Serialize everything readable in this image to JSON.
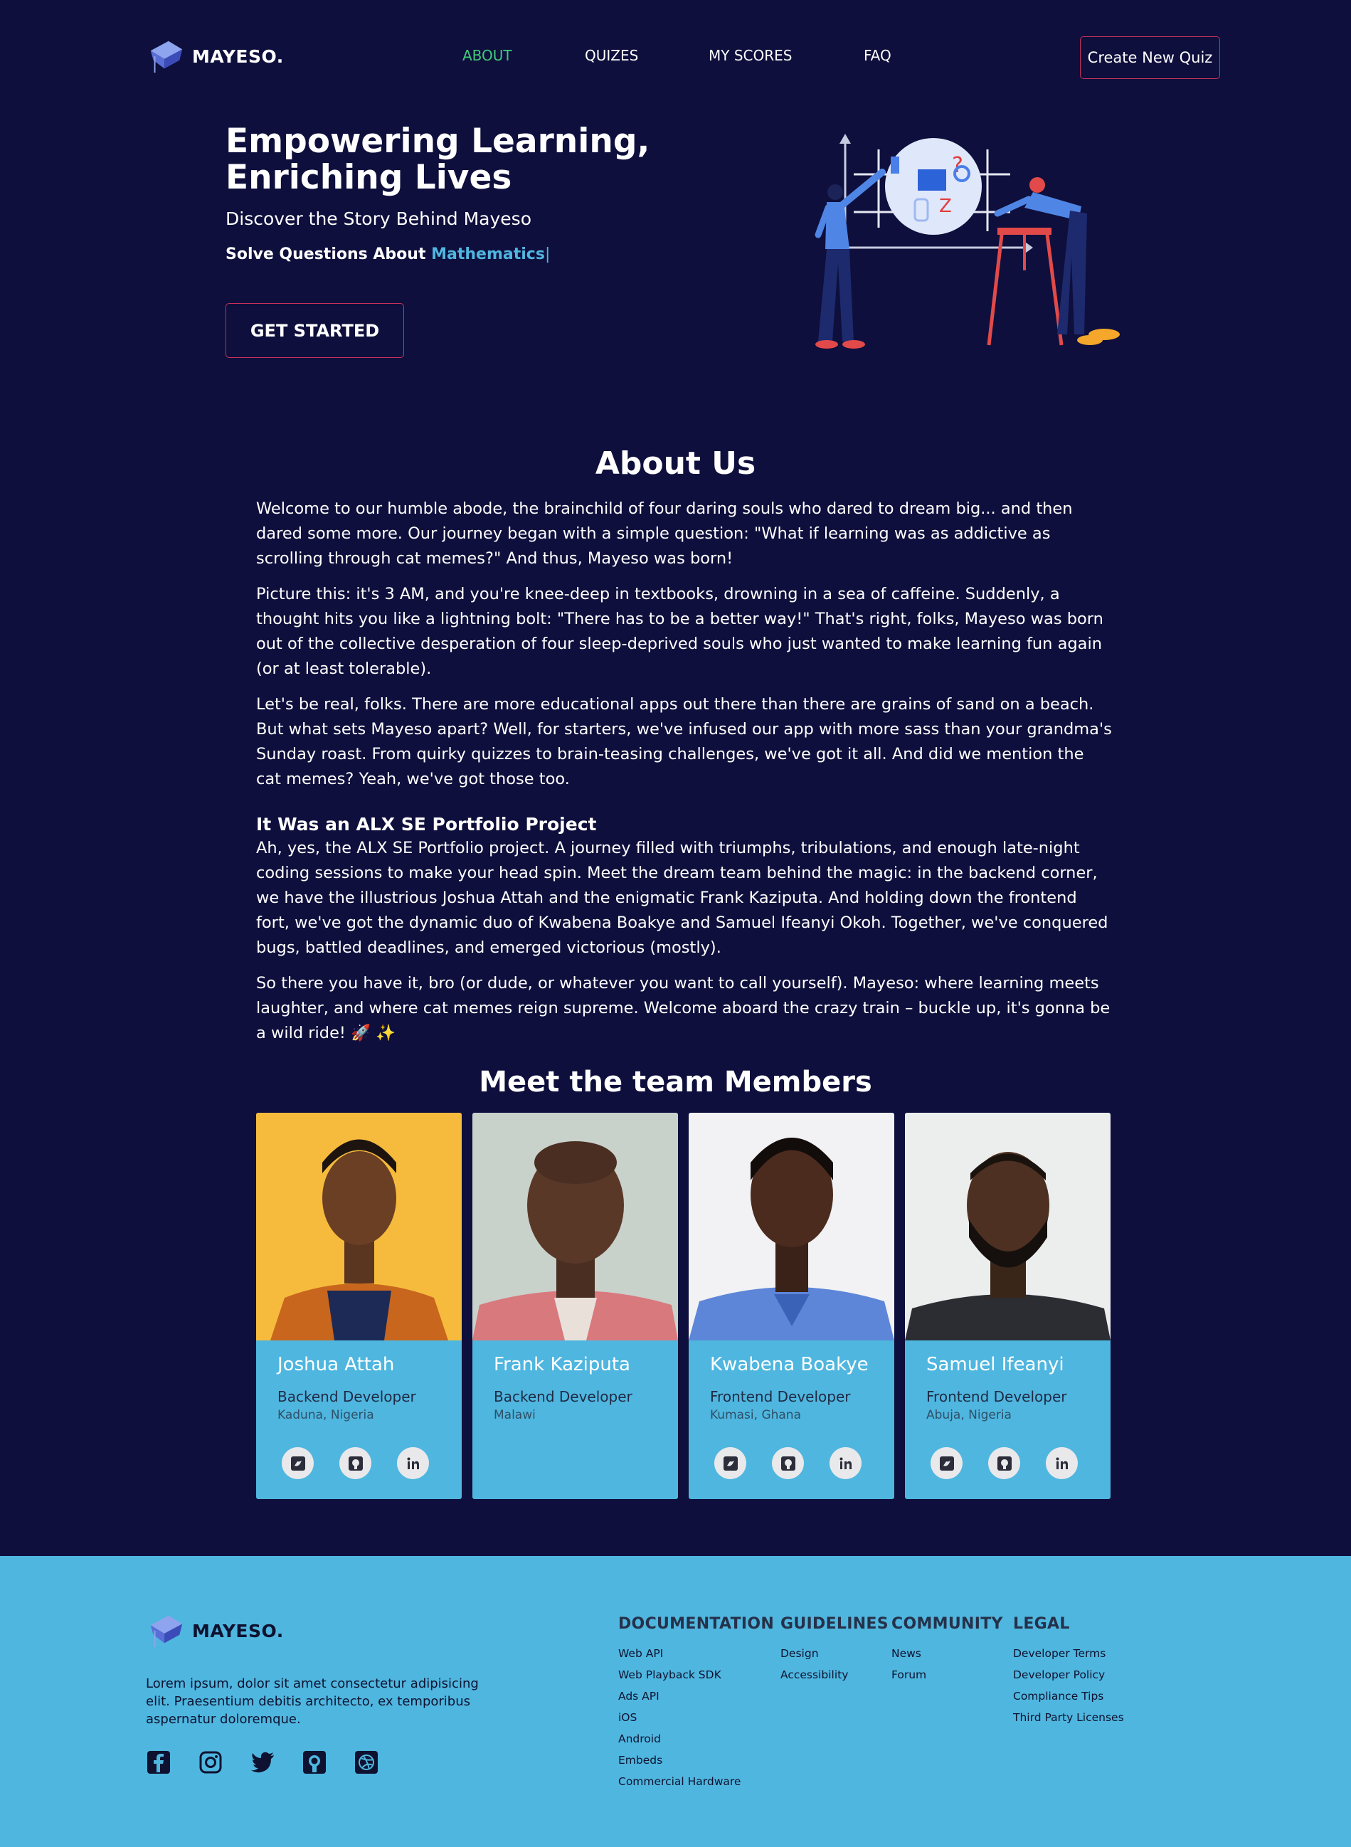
{
  "nav": {
    "brand": "MAYESO.",
    "links": [
      {
        "label": "ABOUT",
        "active": true
      },
      {
        "label": "QUIZES",
        "active": false
      },
      {
        "label": "MY SCORES",
        "active": false
      },
      {
        "label": "FAQ",
        "active": false
      }
    ],
    "create_label": "Create New Quiz"
  },
  "hero": {
    "title": "Empowering Learning, Enriching Lives",
    "subtitle": "Discover the Story Behind Mayeso",
    "solve_prefix": "Solve Questions About ",
    "solve_subject": "Mathematics",
    "cta": "GET STARTED"
  },
  "about": {
    "title": "About Us",
    "paragraphs": [
      "Welcome to our humble abode, the brainchild of four daring souls who dared to dream big... and then dared some more. Our journey began with a simple question: \"What if learning was as addictive as scrolling through cat memes?\" And thus, Mayeso was born!",
      "Picture this: it's 3 AM, and you're knee-deep in textbooks, drowning in a sea of caffeine. Suddenly, a thought hits you like a lightning bolt: \"There has to be a better way!\" That's right, folks, Mayeso was born out of the collective desperation of four sleep-deprived souls who just wanted to make learning fun again (or at least tolerable).",
      "Let's be real, folks. There are more educational apps out there than there are grains of sand on a beach. But what sets Mayeso apart? Well, for starters, we've infused our app with more sass than your grandma's Sunday roast. From quirky quizzes to brain-teasing challenges, we've got it all. And did we mention the cat memes? Yeah, we've got those too."
    ],
    "subheading": "It Was an ALX SE Portfolio Project",
    "paragraphs2": [
      "Ah, yes, the ALX SE Portfolio project. A journey filled with triumphs, tribulations, and enough late-night coding sessions to make your head spin. Meet the dream team behind the magic: in the backend corner, we have the illustrious Joshua Attah and the enigmatic Frank Kaziputa. And holding down the frontend fort, we've got the dynamic duo of Kwabena Boakye and Samuel Ifeanyi Okoh. Together, we've conquered bugs, battled deadlines, and emerged victorious (mostly).",
      "So there you have it, bro (or dude, or whatever you want to call yourself). Mayeso: where learning meets laughter, and where cat memes reign supreme. Welcome aboard the crazy train – buckle up, it's gonna be a wild ride! 🚀 ✨"
    ]
  },
  "team": {
    "title": "Meet the team Members",
    "members": [
      {
        "name": "Joshua Attah",
        "role": "Backend Developer",
        "location": "Kaduna, Nigeria",
        "bg": "#f6bb3c",
        "has_socials": true
      },
      {
        "name": "Frank Kaziputa",
        "role": "Backend Developer",
        "location": "Malawi",
        "bg": "#c9d1cb",
        "has_socials": false
      },
      {
        "name": "Kwabena Boakye",
        "role": "Frontend Developer",
        "location": "Kumasi, Ghana",
        "bg": "#f2f2f4",
        "has_socials": true
      },
      {
        "name": "Samuel Ifeanyi",
        "role": "Frontend Developer",
        "location": "Abuja, Nigeria",
        "bg": "#eceeee",
        "has_socials": true
      }
    ],
    "social_icons": [
      "twitter-icon",
      "github-icon",
      "linkedin-icon"
    ]
  },
  "footer": {
    "brand": "MAYESO.",
    "description": "Lorem ipsum, dolor sit amet consectetur adipisicing elit. Praesentium debitis architecto, ex temporibus aspernatur doloremque.",
    "social_icons": [
      "facebook-icon",
      "instagram-icon",
      "twitter-icon",
      "github-icon",
      "dribbble-icon"
    ],
    "columns": [
      {
        "title": "DOCUMENTATION",
        "links": [
          "Web API",
          "Web Playback SDK",
          "Ads API",
          "iOS",
          "Android",
          "Embeds",
          "Commercial Hardware"
        ]
      },
      {
        "title": "GUIDELINES",
        "links": [
          "Design",
          "Accessibility"
        ]
      },
      {
        "title": "COMMUNITY",
        "links": [
          "News",
          "Forum"
        ]
      },
      {
        "title": "LEGAL",
        "links": [
          "Developer Terms",
          "Developer Policy",
          "Compliance Tips",
          "Third Party Licenses"
        ]
      }
    ]
  },
  "colors": {
    "background": "#0e0f3c",
    "accent_blue": "#4fb6df",
    "active_green": "#3fca7a",
    "button_border": "#c8315b"
  }
}
